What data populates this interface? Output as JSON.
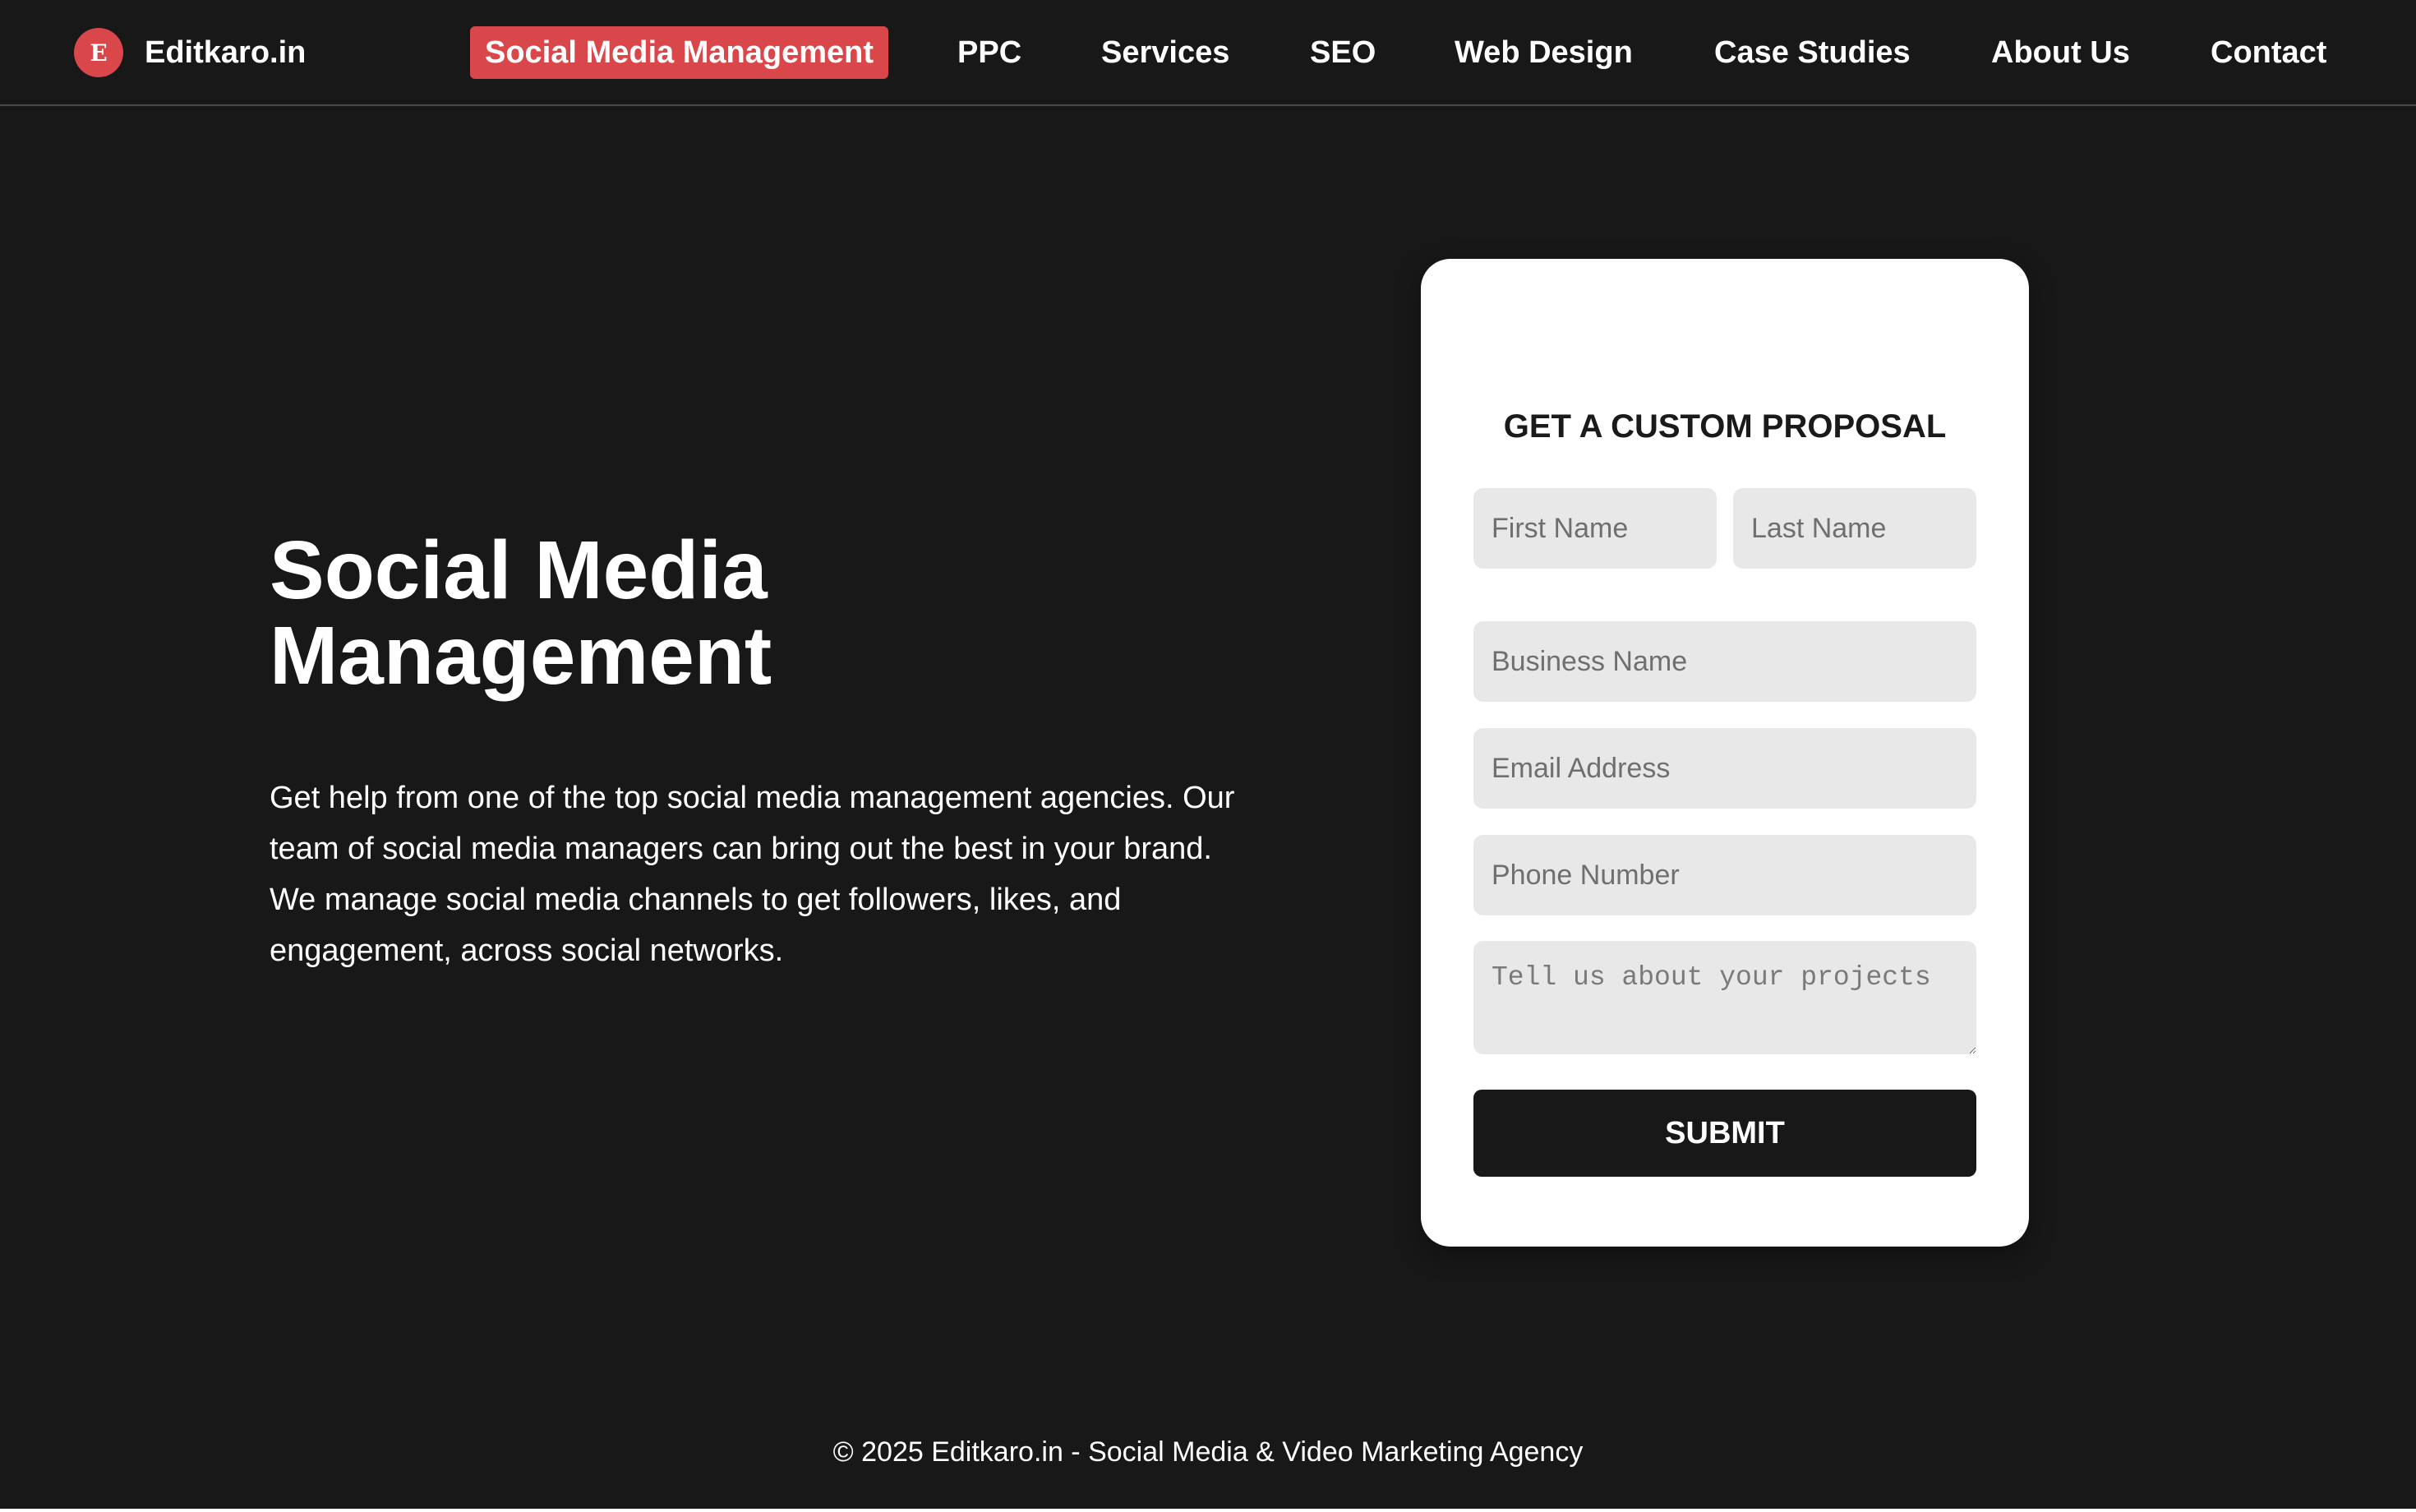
{
  "brand": {
    "logo_letter": "E",
    "name": "Editkaro.in",
    "accent_color": "#d9474a"
  },
  "nav": {
    "items": [
      {
        "label": "Social Media Management",
        "active": true
      },
      {
        "label": "PPC",
        "active": false
      },
      {
        "label": "Services",
        "active": false
      },
      {
        "label": "SEO",
        "active": false
      },
      {
        "label": "Web Design",
        "active": false
      },
      {
        "label": "Case Studies",
        "active": false
      },
      {
        "label": "About Us",
        "active": false
      },
      {
        "label": "Contact",
        "active": false
      }
    ]
  },
  "hero": {
    "title": "Social Media Management",
    "description": "Get help from one of the top social media management agencies. Our team of social media managers can bring out the best in your brand. We manage social media channels to get followers, likes, and engagement, across social networks."
  },
  "form": {
    "title": "GET A CUSTOM PROPOSAL",
    "first_name": {
      "placeholder": "First Name",
      "value": ""
    },
    "last_name": {
      "placeholder": "Last Name",
      "value": ""
    },
    "business_name": {
      "placeholder": "Business Name",
      "value": ""
    },
    "email": {
      "placeholder": "Email Address",
      "value": ""
    },
    "phone": {
      "placeholder": "Phone Number",
      "value": ""
    },
    "project": {
      "placeholder": "Tell us about your projects",
      "value": ""
    },
    "submit_label": "SUBMIT"
  },
  "footer": {
    "text": "© 2025 Editkaro.in - Social Media & Video Marketing Agency"
  },
  "colors": {
    "background": "#181818",
    "card": "#ffffff",
    "field": "#e8e8e8",
    "button": "#181818"
  }
}
